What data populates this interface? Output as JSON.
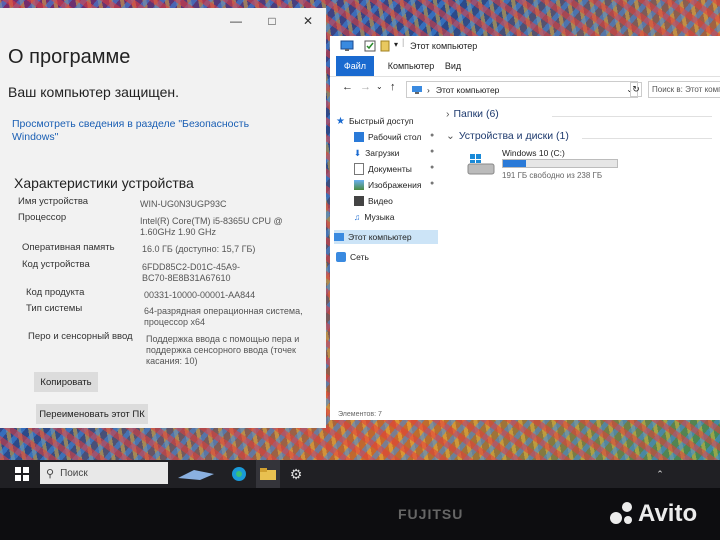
{
  "about": {
    "title": "О программе",
    "protected_text": "Ваш компьютер защищен.",
    "security_link": "Просмотреть сведения в разделе \"Безопасность Windows\"",
    "section_title": "Характеристики устройства",
    "specs": [
      {
        "label": "Имя устройства",
        "value": "WIN-UG0N3UGP93C"
      },
      {
        "label": "Процессор",
        "value": "Intel(R) Core(TM) i5-8365U CPU @ 1.60GHz   1.90 GHz"
      },
      {
        "label": "Оперативная память",
        "value": "16.0 ГБ (доступно: 15,7 ГБ)"
      },
      {
        "label": "Код устройства",
        "value": "6FDD85C2-D01C-45A9-BC70-8E8B31A67610"
      },
      {
        "label": "Код продукта",
        "value": "00331-10000-00001-AA844"
      },
      {
        "label": "Тип системы",
        "value": "64-разрядная операционная система, процессор x64"
      },
      {
        "label": "Перо и сенсорный ввод",
        "value": "Поддержка ввода с помощью пера и поддержка сенсорного ввода (точек касания: 10)"
      }
    ],
    "copy_button": "Копировать",
    "rename_button": "Переименовать этот ПК"
  },
  "explorer": {
    "title": "Этот компьютер",
    "ribbon_tabs": [
      "Файл",
      "Компьютер",
      "Вид"
    ],
    "address": "Этот компьютер",
    "search_placeholder": "Поиск в: Этот компьютер",
    "nav": {
      "quick_access": "Быстрый доступ",
      "desktop": "Рабочий стол",
      "downloads": "Загрузки",
      "documents": "Документы",
      "pictures": "Изображения",
      "video": "Видео",
      "music": "Музыка",
      "this_pc": "Этот компьютер",
      "network": "Сеть"
    },
    "folders_group": "Папки (6)",
    "devices_group": "Устройства и диски (1)",
    "drive_name": "Windows 10 (C:)",
    "drive_free": "191 ГБ свободно из 238 ГБ",
    "drive_used_fraction": 0.2,
    "status_text": "Элементов: 7"
  },
  "taskbar": {
    "search_placeholder": "Поиск"
  },
  "bezel": {
    "brand": "FUJITSU",
    "watermark": "Avito"
  },
  "colors": {
    "accent": "#0a64c8",
    "link": "#1a5fb4",
    "drive_bar": "#2a7ad8"
  }
}
